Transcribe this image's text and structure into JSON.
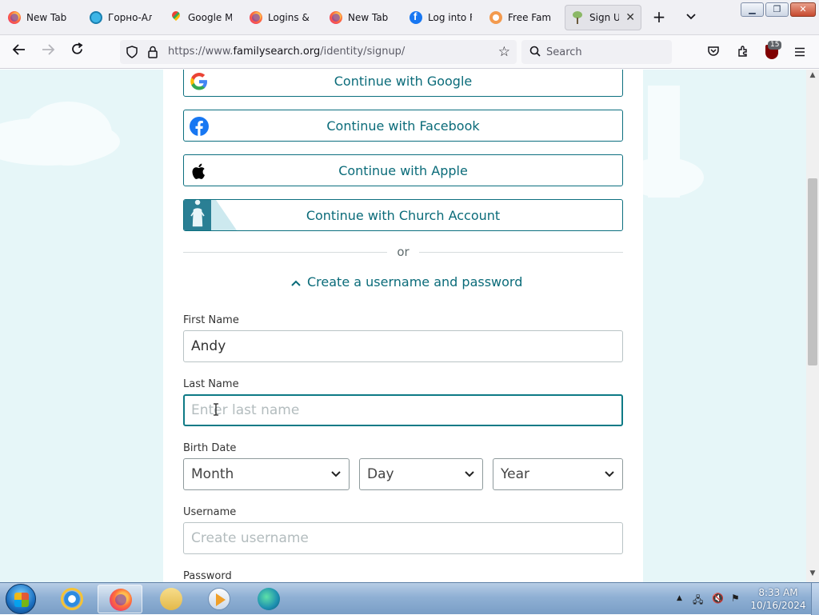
{
  "browser": {
    "tabs": [
      {
        "title": "New Tab",
        "favicon": "firefox-icon"
      },
      {
        "title": "Горно-Ал",
        "favicon": "gorno-icon"
      },
      {
        "title": "Google Ma",
        "favicon": "google-maps-icon"
      },
      {
        "title": "Logins & P",
        "favicon": "firefox-icon"
      },
      {
        "title": "New Tab",
        "favicon": "firefox-icon"
      },
      {
        "title": "Log into F",
        "favicon": "facebook-icon"
      },
      {
        "title": "Free Famil",
        "favicon": "free-family-icon"
      },
      {
        "title": "Sign Up",
        "favicon": "familysearch-tree-icon",
        "active": true
      }
    ],
    "url_prefix": "https://www.",
    "url_domain": "familysearch.org",
    "url_path": "/identity/signup/",
    "search_placeholder": "Search",
    "ublock_count": "15"
  },
  "page": {
    "sso": {
      "google": "Continue with Google",
      "facebook": "Continue with Facebook",
      "apple": "Continue with Apple",
      "church": "Continue with Church Account"
    },
    "or_text": "or",
    "toggle_label": "Create a username and password",
    "fields": {
      "first_name_label": "First Name",
      "first_name_value": "Andy",
      "last_name_label": "Last Name",
      "last_name_placeholder": "Enter last name",
      "birth_date_label": "Birth Date",
      "month": "Month",
      "day": "Day",
      "year": "Year",
      "username_label": "Username",
      "username_placeholder": "Create username",
      "password_label": "Password"
    }
  },
  "taskbar": {
    "time": "8:33 AM",
    "date": "10/16/2024"
  },
  "colors": {
    "accent": "#0a6b79",
    "page_bg": "#e6f6f8",
    "focus_border": "#0e7a86"
  }
}
